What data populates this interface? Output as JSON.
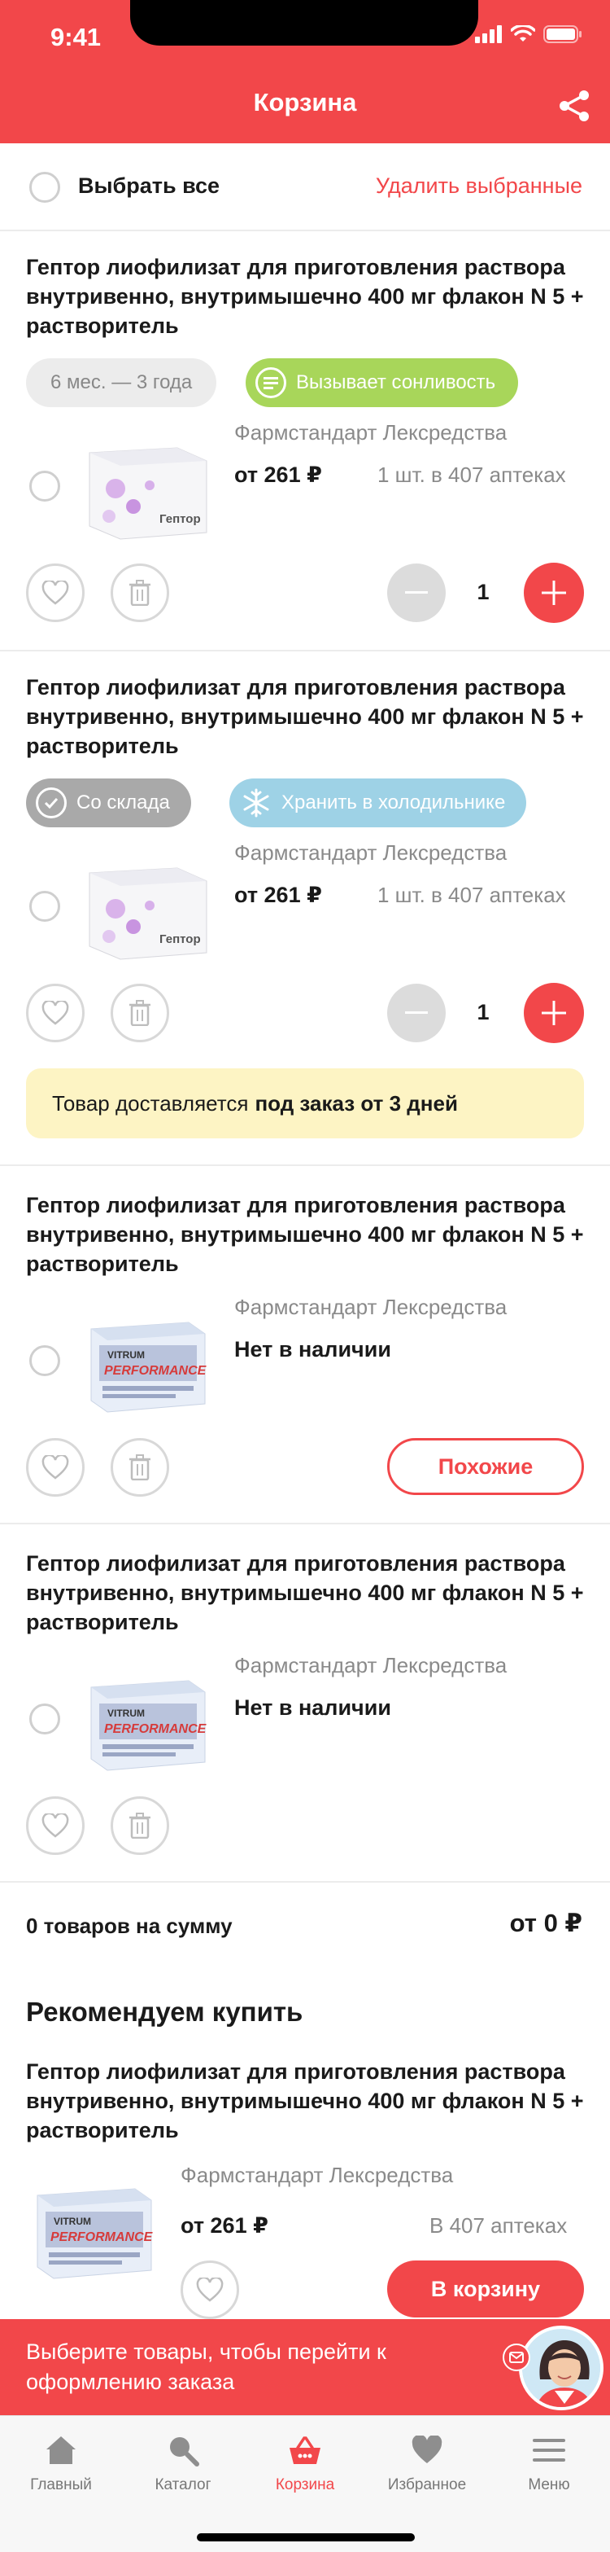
{
  "status_bar": {
    "time": "9:41"
  },
  "header": {
    "title": "Корзина"
  },
  "select_row": {
    "select_all_label": "Выбрать все",
    "delete_selected_label": "Удалить выбранные"
  },
  "cart_items": [
    {
      "title": "Гептор лиофилизат для приготовления раствора внутривенно, внутримышечно 400 мг флакон N 5 + растворитель",
      "chip_primary": "6 мес. — 3 года",
      "chip_secondary": "Вызывает сонливость",
      "maker": "Фармстандарт Лексредства",
      "price": "от 261 ₽",
      "availability": "1 шт. в 407 аптеках",
      "quantity": "1",
      "image": "geptor-box"
    },
    {
      "title": "Гептор лиофилизат для приготовления раствора внутривенно, внутримышечно 400 мг флакон N 5 + растворитель",
      "chip_primary": "Со склада",
      "chip_secondary": "Хранить в холодильнике",
      "maker": "Фармстандарт Лексредства",
      "price": "от 261 ₽",
      "availability": "1 шт. в 407 аптеках",
      "quantity": "1",
      "notice_text": "Товар доставляется",
      "notice_bold": "под заказ от 3 дней",
      "image": "geptor-box"
    },
    {
      "title": "Гептор лиофилизат для приготовления раствора внутривенно, внутримышечно 400 мг флакон N 5 + растворитель",
      "maker": "Фармстандарт Лексредства",
      "stock_status": "Нет в наличии",
      "similar_label": "Похожие",
      "image": "vitrum-performance-box"
    },
    {
      "title": "Гептор лиофилизат для приготовления раствора внутривенно, внутримышечно 400 мг флакон N 5 + растворитель",
      "maker": "Фармстандарт Лексредства",
      "stock_status": "Нет в наличии",
      "image": "vitrum-performance-box"
    }
  ],
  "summary": {
    "label": "0 товаров на сумму",
    "total": "от 0 ₽"
  },
  "recommended": {
    "heading": "Рекомендуем купить",
    "item": {
      "title": "Гептор лиофилизат для приготовления раствора внутривенно, внутримышечно 400 мг флакон N 5 + растворитель",
      "maker": "Фармстандарт Лексредства",
      "price": "от 261 ₽",
      "availability": "В 407 аптеках",
      "to_cart_label": "В корзину",
      "image": "vitrum-performance-box"
    }
  },
  "checkout_banner": {
    "text": "Выберите товары, чтобы перейти к оформлению заказа"
  },
  "tabbar": {
    "items": [
      {
        "label": "Главный",
        "icon": "home-icon"
      },
      {
        "label": "Каталог",
        "icon": "search-icon"
      },
      {
        "label": "Корзина",
        "icon": "basket-icon",
        "active": true
      },
      {
        "label": "Избранное",
        "icon": "heart-icon"
      },
      {
        "label": "Меню",
        "icon": "menu-icon"
      }
    ]
  },
  "colors": {
    "accent": "#f2474a",
    "chip_green": "#a8d65a",
    "chip_blue": "#9ed2e6",
    "notice_bg": "#fdf4c4"
  }
}
